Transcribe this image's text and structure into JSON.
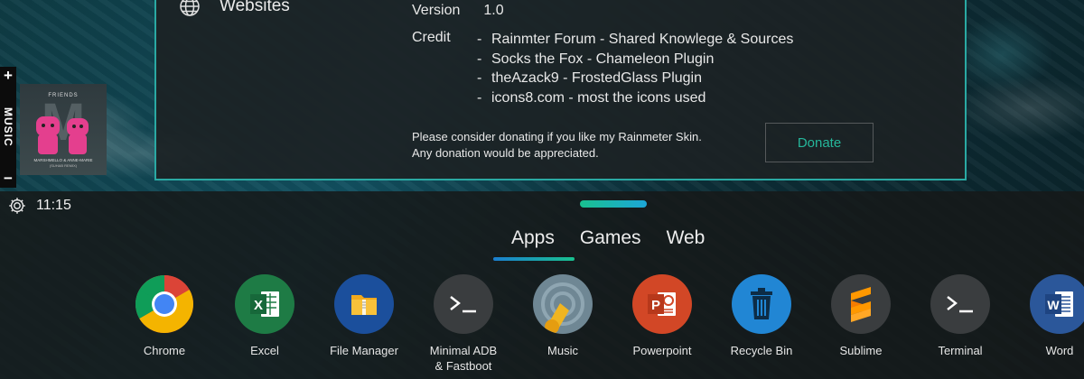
{
  "about": {
    "nav_label": "Websites",
    "version_label": "Version",
    "version_value": "1.0",
    "credit_label": "Credit",
    "credits": [
      "Rainmter Forum - Shared Knowlege & Sources",
      "Socks the Fox - Chameleon Plugin",
      "theAzack9 - FrostedGlass Plugin",
      "icons8.com - most the icons used"
    ],
    "donate_line1": "Please consider donating if you like my Rainmeter Skin.",
    "donate_line2": "Any donation would be appreciated.",
    "donate_button": "Donate",
    "accent": "#2aa9a3"
  },
  "music": {
    "plus": "+",
    "minus": "−",
    "label": "MUSIC",
    "album_title": "FRIENDS",
    "album_artist": "MARSHMELLO & ANNE-MARIE",
    "album_sub": "(SUHAB REMIX)"
  },
  "clock": {
    "time": "11:15",
    "icon": "gear-icon"
  },
  "tabs": [
    {
      "label": "Apps",
      "active": true
    },
    {
      "label": "Games",
      "active": false
    },
    {
      "label": "Web",
      "active": false
    }
  ],
  "apps": [
    {
      "label": "Chrome",
      "icon": "chrome-icon"
    },
    {
      "label": "Excel",
      "icon": "excel-icon"
    },
    {
      "label": "File Manager",
      "icon": "file-manager-icon"
    },
    {
      "label": "Minimal ADB\n& Fastboot",
      "icon": "terminal-icon"
    },
    {
      "label": "Music",
      "icon": "music-icon"
    },
    {
      "label": "Powerpoint",
      "icon": "powerpoint-icon"
    },
    {
      "label": "Recycle Bin",
      "icon": "recycle-bin-icon"
    },
    {
      "label": "Sublime",
      "icon": "sublime-icon"
    },
    {
      "label": "Terminal",
      "icon": "terminal-icon"
    },
    {
      "label": "Word",
      "icon": "word-icon"
    }
  ]
}
